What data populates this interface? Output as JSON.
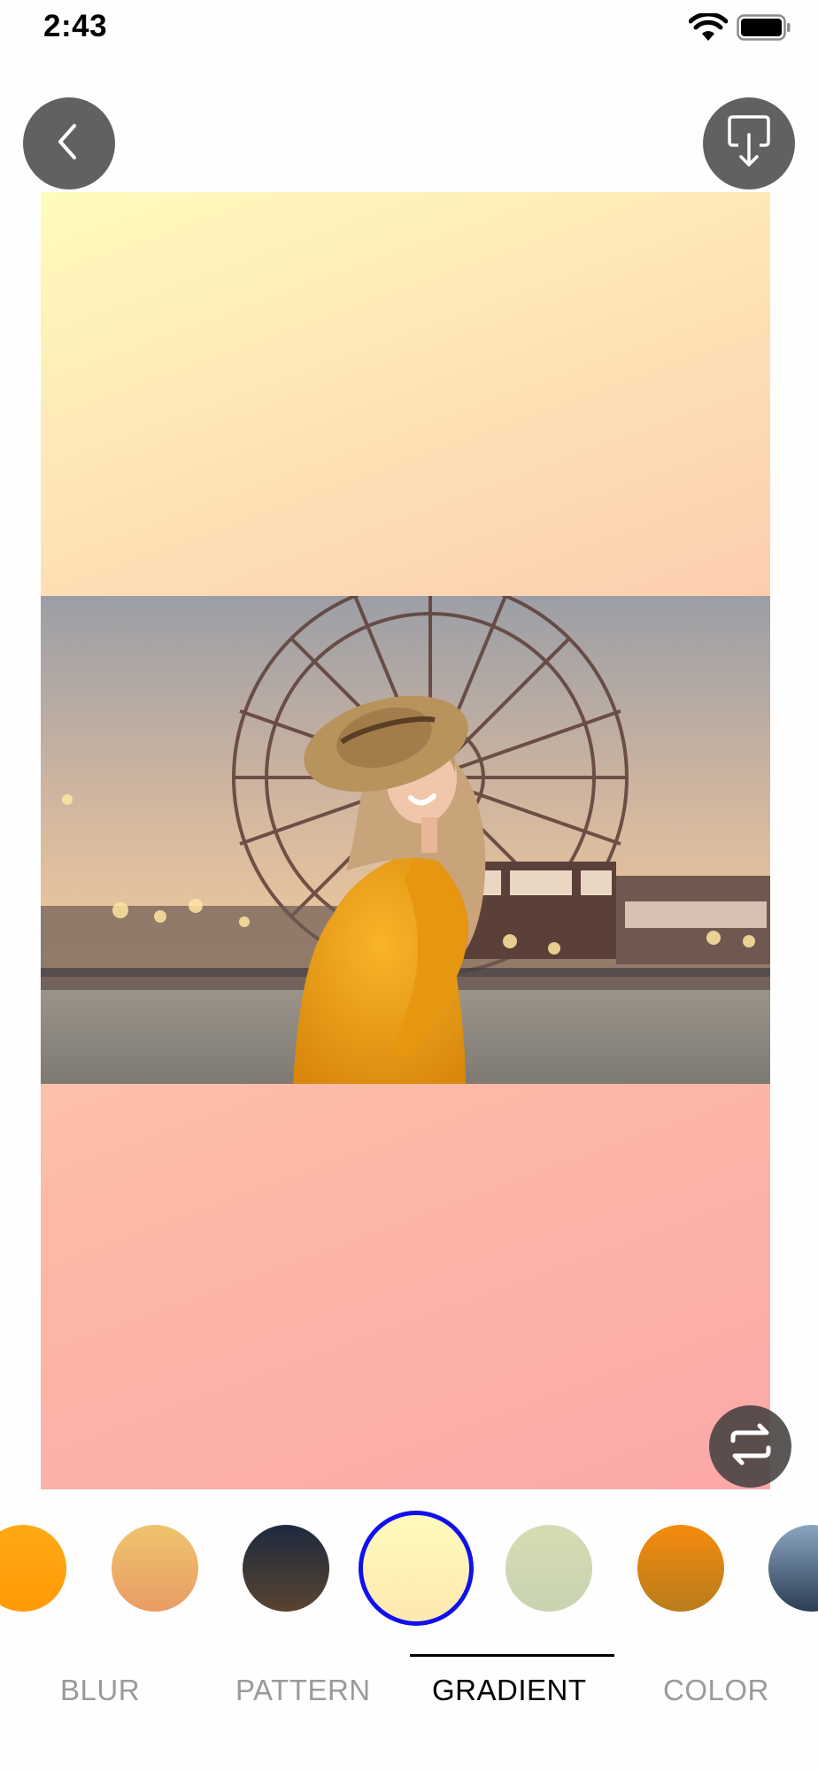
{
  "status_bar": {
    "time": "2:43"
  },
  "toolbar": {
    "back_icon": "chevron-left-icon",
    "download_icon": "download-icon",
    "swap_icon": "swap-arrows-icon"
  },
  "canvas": {
    "background_gradient": [
      "#fffbbd",
      "#fdd8b2",
      "#fdb9a6",
      "#fca8a8"
    ],
    "photo": "woman in yellow dress and straw hat in front of a ferris wheel"
  },
  "swatches": [
    {
      "colors": [
        "#ffa915",
        "#ff9a05"
      ],
      "selected": false
    },
    {
      "colors": [
        "#efc46e",
        "#e99c64"
      ],
      "selected": false
    },
    {
      "colors": [
        "#1c2a3e",
        "#5a4330"
      ],
      "selected": false
    },
    {
      "colors": [
        "#fffbbd",
        "#fde8b0"
      ],
      "selected": true
    },
    {
      "colors": [
        "#d5dcb3",
        "#c9d3b1"
      ],
      "selected": false
    },
    {
      "colors": [
        "#f58b0c",
        "#b87c1c"
      ],
      "selected": false
    },
    {
      "colors": [
        "#8aa6c2",
        "#2c3d52"
      ],
      "selected": false
    }
  ],
  "tabs": [
    {
      "label": "BLUR",
      "active": false
    },
    {
      "label": "PATTERN",
      "active": false
    },
    {
      "label": "GRADIENT",
      "active": true
    },
    {
      "label": "COLOR",
      "active": false
    }
  ],
  "colors": {
    "selection_ring": "#1010ee",
    "tab_active": "#000000",
    "tab_inactive": "#9a9a9a"
  }
}
